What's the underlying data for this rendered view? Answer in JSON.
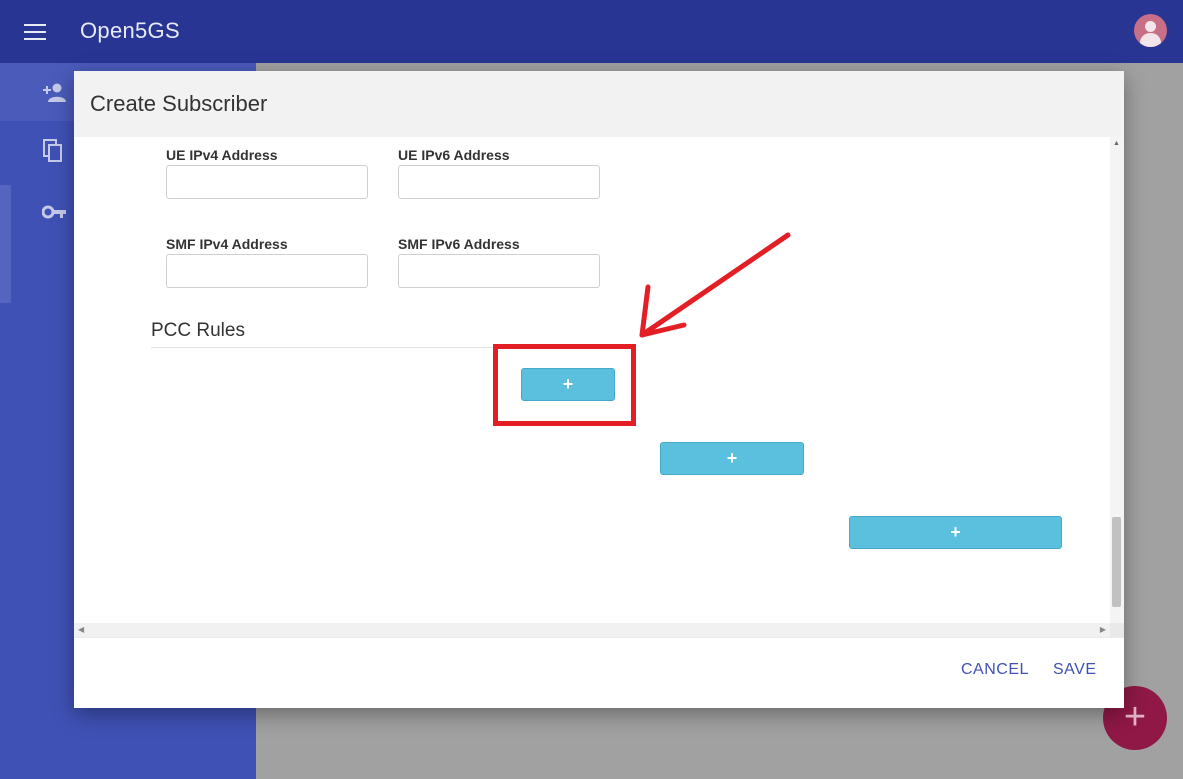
{
  "app": {
    "title": "Open5GS"
  },
  "icons": {
    "menu": "menu-icon",
    "avatar": "account-circle-icon",
    "subscriber": "person-add-icon",
    "profile": "copy-icon",
    "account": "key-icon",
    "fab": "add-icon"
  },
  "sidebar": {
    "items": [
      {
        "icon": "person-add-icon",
        "glyph": "➕"
      },
      {
        "icon": "copy-icon",
        "glyph": "❐"
      },
      {
        "icon": "key-icon",
        "glyph": "⚿"
      }
    ]
  },
  "dialog": {
    "title": "Create Subscriber",
    "fields": {
      "ue_ipv4_label": "UE IPv4 Address",
      "ue_ipv4_value": "",
      "ue_ipv6_label": "UE IPv6 Address",
      "ue_ipv6_value": "",
      "smf_ipv4_label": "SMF IPv4 Address",
      "smf_ipv4_value": "",
      "smf_ipv6_label": "SMF IPv6 Address",
      "smf_ipv6_value": ""
    },
    "pcc": {
      "section_title": "PCC Rules",
      "add_label": "+"
    },
    "actions": {
      "cancel": "CANCEL",
      "save": "SAVE"
    }
  },
  "fab": {
    "label": "+"
  },
  "annotation": {
    "color": "#e31e24"
  },
  "colors": {
    "appbar": "#283593",
    "sidebar": "#3f51b5",
    "add_button": "#5bc0de",
    "accent": "#3f51b5",
    "fab": "#8f1847"
  }
}
